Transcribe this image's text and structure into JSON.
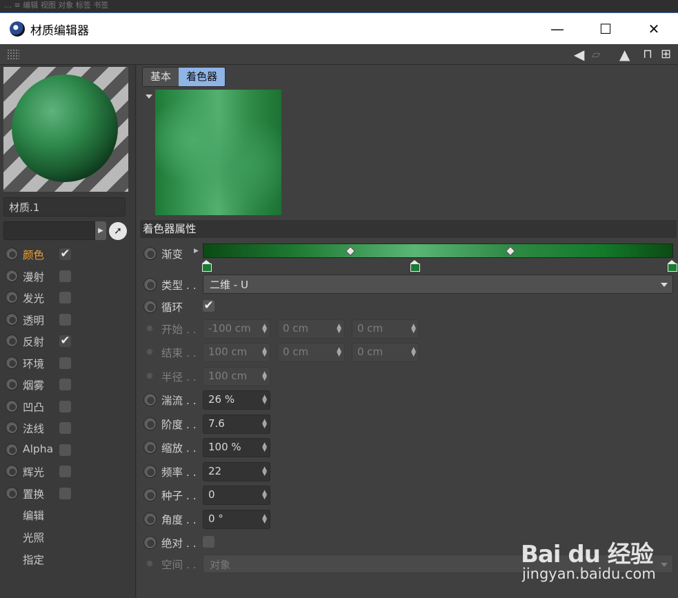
{
  "background_strip": "…  ≡ 编辑  视图  对象  标签  书签",
  "window": {
    "title": "材质编辑器",
    "minimize": "—",
    "maximize": "☐",
    "close": "✕"
  },
  "toolbar": {
    "icons": [
      "back-arrow-icon",
      "forward-arrow-icon",
      "cursor-up-icon",
      "lock-icon",
      "new-window-icon"
    ]
  },
  "material": {
    "name": "材质.1",
    "layer_value": ""
  },
  "channels": [
    {
      "label": "颜色",
      "checked": true,
      "active": true
    },
    {
      "label": "漫射",
      "checked": false
    },
    {
      "label": "发光",
      "checked": false
    },
    {
      "label": "透明",
      "checked": false
    },
    {
      "label": "反射",
      "checked": true
    },
    {
      "label": "环境",
      "checked": false
    },
    {
      "label": "烟雾",
      "checked": false
    },
    {
      "label": "凹凸",
      "checked": false
    },
    {
      "label": "法线",
      "checked": false
    },
    {
      "label": "Alpha",
      "checked": false
    },
    {
      "label": "辉光",
      "checked": false
    },
    {
      "label": "置换",
      "checked": false
    }
  ],
  "extra_items": [
    "编辑",
    "光照",
    "指定"
  ],
  "tabs": [
    "基本",
    "着色器"
  ],
  "section_title": "着色器属性",
  "params": {
    "gradient": {
      "label": "渐变"
    },
    "type": {
      "label": "类型 . .",
      "value": "二维 - U"
    },
    "cycle": {
      "label": "循环",
      "checked": true
    },
    "start": {
      "label": "开始 . .",
      "v1": "-100 cm",
      "v2": "0 cm",
      "v3": "0 cm"
    },
    "end": {
      "label": "结束 . .",
      "v1": "100 cm",
      "v2": "0 cm",
      "v3": "0 cm"
    },
    "radius": {
      "label": "半径 . .",
      "v1": "100 cm"
    },
    "turbulence": {
      "label": "湍流 . .",
      "value": "26 %"
    },
    "octaves": {
      "label": "阶度 . .",
      "value": "7.6"
    },
    "scale": {
      "label": "缩放 . .",
      "value": "100 %"
    },
    "frequency": {
      "label": "频率 . .",
      "value": "22"
    },
    "seed": {
      "label": "种子 . .",
      "value": "0"
    },
    "angle": {
      "label": "角度 . .",
      "value": "0 °"
    },
    "absolute": {
      "label": "绝对 . .",
      "checked": false
    },
    "space": {
      "label": "空间 . .",
      "value": "对象"
    }
  },
  "check_mark": "✔",
  "watermark": {
    "logo": "Bai du 经验",
    "url": "jingyan.baidu.com"
  }
}
